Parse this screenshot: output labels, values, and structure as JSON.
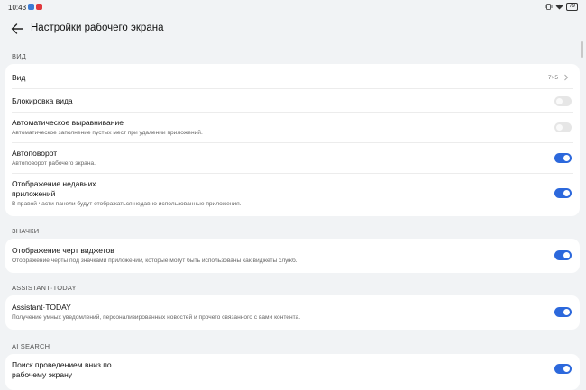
{
  "status": {
    "time": "10:43",
    "battery": "79"
  },
  "header": {
    "title": "Настройки рабочего экрана"
  },
  "sections": {
    "view": {
      "label": "ВИД",
      "layout": {
        "title": "Вид",
        "value": "7×5"
      },
      "lock": {
        "title": "Блокировка вида",
        "enabled": false
      },
      "auto_align": {
        "title": "Автоматическое выравнивание",
        "subtitle": "Автоматическое заполнение пустых мест при удалении приложений.",
        "enabled": false
      },
      "auto_rotate": {
        "title": "Автоповорот",
        "subtitle": "Автоповорот рабочего экрана.",
        "enabled": true
      },
      "recent_apps": {
        "title_line1": "Отображение недавних",
        "title_line2": "приложений",
        "subtitle": "В правой части панели будут отображаться недавно использованные приложения.",
        "enabled": true
      }
    },
    "icons": {
      "label": "ЗНАЧКИ",
      "widget_traits": {
        "title": "Отображение черт виджетов",
        "subtitle": "Отображение черты под значками приложений, которые могут быть использованы как виджеты служб.",
        "enabled": true
      }
    },
    "assistant": {
      "label": "ASSISTANT·TODAY",
      "today": {
        "title": "Assistant·TODAY",
        "subtitle": "Получение умных уведомлений, персонализированных новостей и прочего связанного с вами контента.",
        "enabled": true
      }
    },
    "ai_search": {
      "label": "AI SEARCH",
      "swipe_search": {
        "title_line1": "Поиск проведением вниз по",
        "title_line2": "рабочему экрану",
        "enabled": true
      }
    }
  },
  "colors": {
    "accent": "#2c68dc",
    "background": "#f1f3f5",
    "card": "#ffffff"
  }
}
